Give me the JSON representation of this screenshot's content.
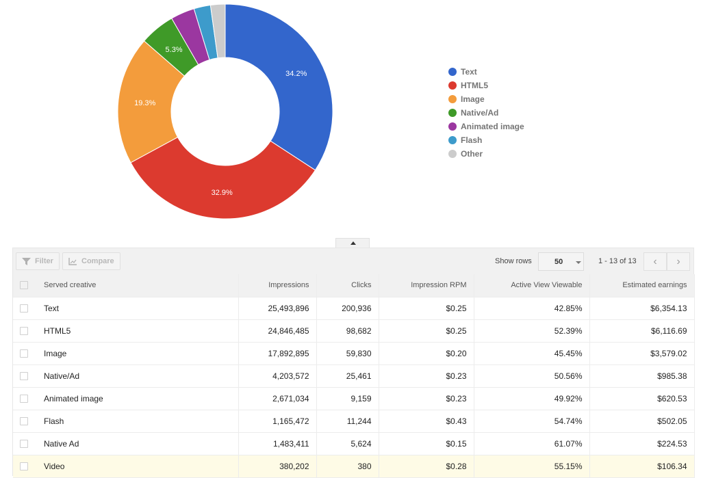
{
  "chart_data": {
    "type": "pie",
    "donut": true,
    "title": "",
    "start_angle_deg": 0,
    "direction": "clockwise",
    "slices": [
      {
        "label": "Text",
        "value": 34.2,
        "color": "#3366cc",
        "data_label": "34.2%"
      },
      {
        "label": "HTML5",
        "value": 32.9,
        "color": "#dc3912",
        "data_label": "32.9%"
      },
      {
        "label": "Image",
        "value": 19.3,
        "color": "#ff9900",
        "data_label": "19.3%"
      },
      {
        "label": "Native/Ad",
        "value": 5.3,
        "color": "#109618",
        "data_label": "5.3%"
      },
      {
        "label": "Animated image",
        "value": 3.6,
        "color": "#990099",
        "data_label": ""
      },
      {
        "label": "Flash",
        "value": 2.5,
        "color": "#3b9ccc",
        "data_label": ""
      },
      {
        "label": "Other",
        "value": 2.2,
        "color": "#cccccc",
        "data_label": ""
      }
    ],
    "legend_position": "right"
  },
  "slice_colors_rendered": {
    "Text": "#3366cc",
    "HTML5": "#dc3a2f",
    "Image": "#f39c3c",
    "Native/Ad": "#3f9a28",
    "Animated image": "#9b37a0",
    "Flash": "#3d9bcb",
    "Other": "#cccccc"
  },
  "legend": {
    "items": [
      "Text",
      "HTML5",
      "Image",
      "Native/Ad",
      "Animated image",
      "Flash",
      "Other"
    ]
  },
  "toolbar": {
    "filter_label": "Filter",
    "compare_label": "Compare",
    "show_rows_label": "Show rows",
    "rows_value": "50",
    "page_range": "1 - 13 of 13"
  },
  "table": {
    "columns": [
      "Served creative",
      "Impressions",
      "Clicks",
      "Impression RPM",
      "Active View Viewable",
      "Estimated earnings"
    ],
    "rows": [
      {
        "name": "Text",
        "impressions": "25,493,896",
        "clicks": "200,936",
        "rpm": "$0.25",
        "viewable": "42.85%",
        "earnings": "$6,354.13",
        "highlight": false
      },
      {
        "name": "HTML5",
        "impressions": "24,846,485",
        "clicks": "98,682",
        "rpm": "$0.25",
        "viewable": "52.39%",
        "earnings": "$6,116.69",
        "highlight": false
      },
      {
        "name": "Image",
        "impressions": "17,892,895",
        "clicks": "59,830",
        "rpm": "$0.20",
        "viewable": "45.45%",
        "earnings": "$3,579.02",
        "highlight": false
      },
      {
        "name": "Native/Ad",
        "impressions": "4,203,572",
        "clicks": "25,461",
        "rpm": "$0.23",
        "viewable": "50.56%",
        "earnings": "$985.38",
        "highlight": false
      },
      {
        "name": "Animated image",
        "impressions": "2,671,034",
        "clicks": "9,159",
        "rpm": "$0.23",
        "viewable": "49.92%",
        "earnings": "$620.53",
        "highlight": false
      },
      {
        "name": "Flash",
        "impressions": "1,165,472",
        "clicks": "11,244",
        "rpm": "$0.43",
        "viewable": "54.74%",
        "earnings": "$502.05",
        "highlight": false
      },
      {
        "name": "Native Ad",
        "impressions": "1,483,411",
        "clicks": "5,624",
        "rpm": "$0.15",
        "viewable": "61.07%",
        "earnings": "$224.53",
        "highlight": false
      },
      {
        "name": "Video",
        "impressions": "380,202",
        "clicks": "380",
        "rpm": "$0.28",
        "viewable": "55.15%",
        "earnings": "$106.34",
        "highlight": true
      }
    ]
  }
}
